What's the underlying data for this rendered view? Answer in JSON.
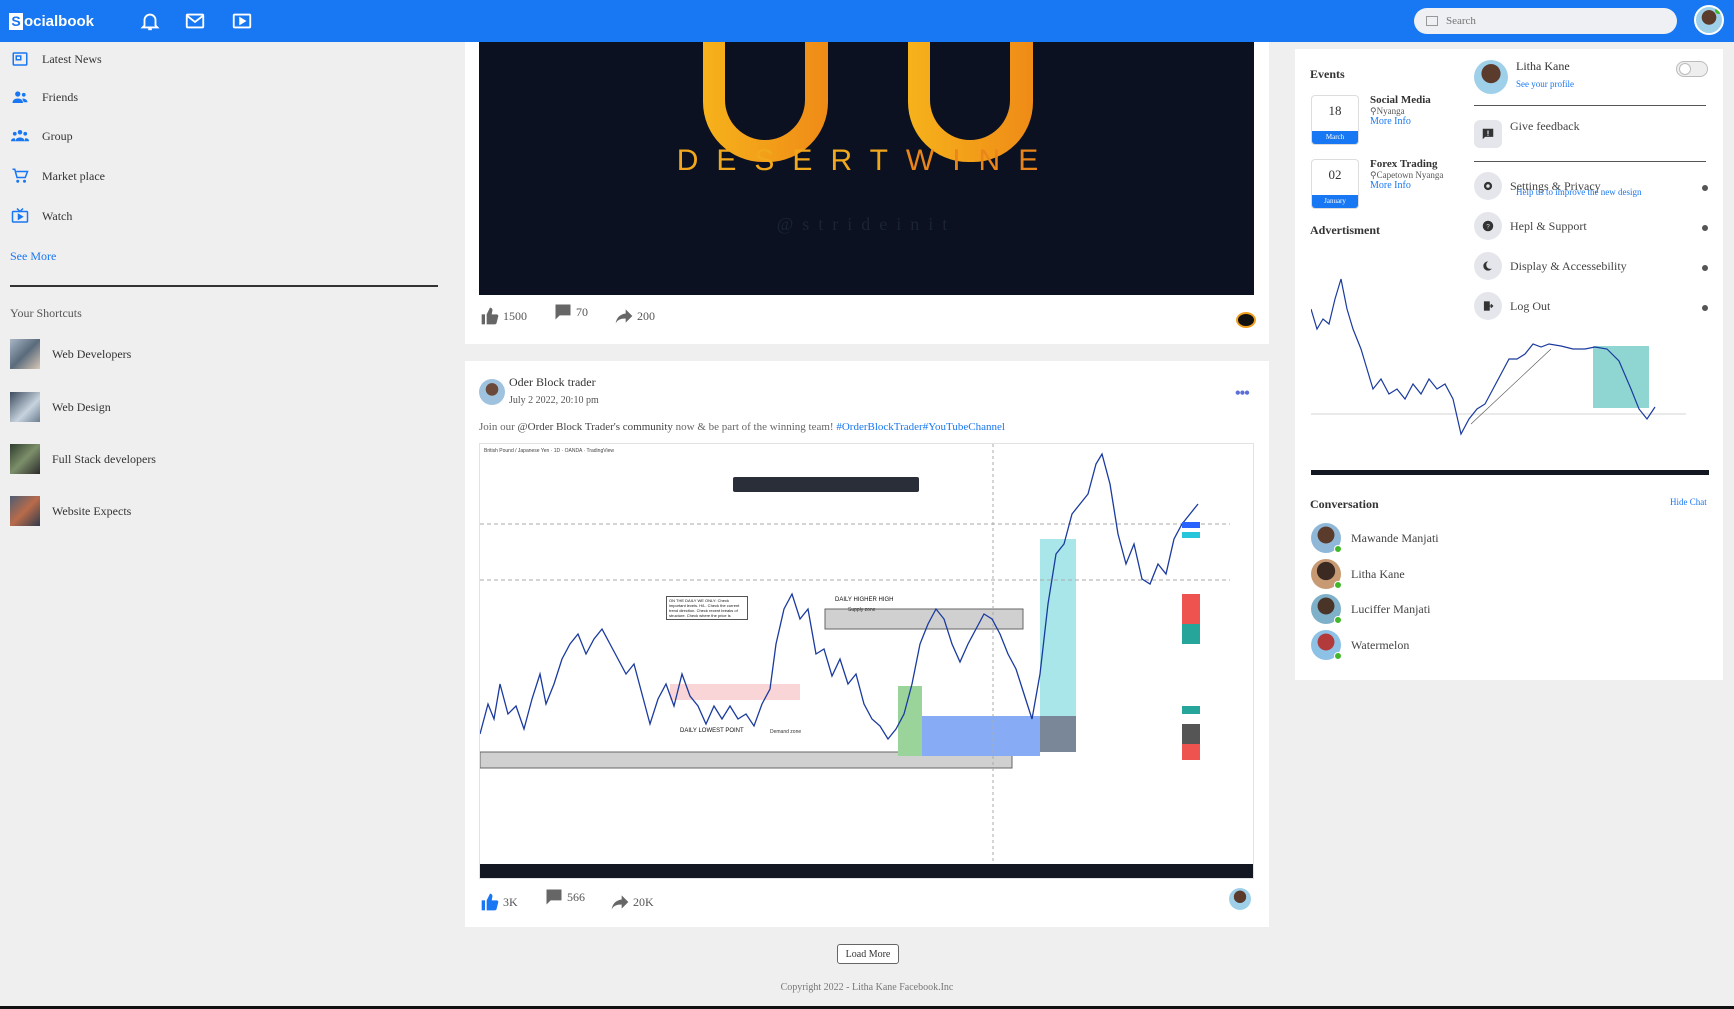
{
  "header": {
    "logo_letter": "S",
    "logo_rest": "ocialbook",
    "search_placeholder": "Search"
  },
  "sidebar": {
    "items": [
      {
        "label": "Latest News",
        "icon": "news-icon"
      },
      {
        "label": "Friends",
        "icon": "friends-icon"
      },
      {
        "label": "Group",
        "icon": "group-icon"
      },
      {
        "label": "Market place",
        "icon": "cart-icon"
      },
      {
        "label": "Watch",
        "icon": "tv-icon"
      }
    ],
    "see_more": "See More",
    "shortcuts_title": "Your Shortcuts",
    "shortcuts": [
      {
        "label": "Web Developers"
      },
      {
        "label": "Web Design"
      },
      {
        "label": "Full Stack developers"
      },
      {
        "label": "Website Expects"
      }
    ]
  },
  "post1": {
    "brand_left": "DESERT",
    "brand_right": "WINE",
    "handle": "@strideinit",
    "likes": "1500",
    "comments": "70",
    "shares": "200"
  },
  "post2": {
    "author": "Oder Block trader",
    "date": "July 2 2022, 20:10 pm",
    "text_pre": "Join our ",
    "text_bold": "@Order Block Trader's community",
    "text_mid": " now & be part of the winning team! ",
    "text_tags": "#OrderBlockTrader#YouTubeChannel",
    "likes": "3K",
    "comments": "566",
    "shares": "20K",
    "chart_header": "British Pound / Japanese Yen · 1D · OANDA · TradingView",
    "chart_label_high": "DAILY HIGHER HIGH",
    "chart_label_supply": "Supply zone",
    "chart_label_low": "DAILY LOWEST POINT",
    "chart_label_demand": "Demand zone",
    "chart_note": "ON THE DAILY WE ONLY: Check important levels. H/L. Check the current trend direction. Check recent breaks of structure. Check where the price is currently."
  },
  "feed": {
    "load_more": "Load More",
    "copyright": "Copyright 2022 - Litha Kane Facebook.Inc"
  },
  "events": {
    "title": "Events",
    "items": [
      {
        "day": "18",
        "month": "March",
        "title": "Social Media",
        "location": "Nyanga",
        "link": "More Info"
      },
      {
        "day": "02",
        "month": "January",
        "title": "Forex Trading",
        "location": "Capetown Nyanga",
        "link": "More Info"
      }
    ]
  },
  "advert": {
    "title": "Advertisment"
  },
  "conversation": {
    "title": "Conversation",
    "hide": "Hide Chat",
    "people": [
      "Mawande Manjati",
      "Litha Kane",
      "Luciffer Manjati",
      "Watermelon"
    ]
  },
  "dropdown": {
    "name": "Litha Kane",
    "see_profile": "See your profile",
    "feedback": "Give feedback",
    "feedback_sub": "Help us to improve the new design",
    "settings": "Settings & Privacy",
    "help": "Hepl & Support",
    "display": "Display & Accessebility",
    "logout": "Log Out"
  },
  "colors": {
    "brand": "#1877f2",
    "online": "#42b72a"
  }
}
